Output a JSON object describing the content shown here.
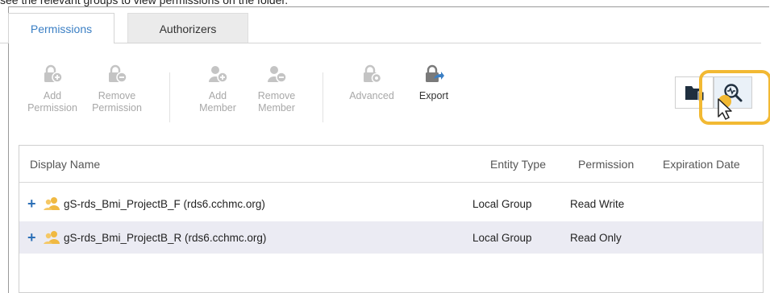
{
  "caption": "see the relevant groups to view permissions on the folder.",
  "tabs": [
    {
      "label": "Permissions",
      "active": true
    },
    {
      "label": "Authorizers",
      "active": false
    }
  ],
  "toolbar": {
    "add_permission": {
      "line1": "Add",
      "line2": "Permission",
      "icon": "lock-add-icon"
    },
    "remove_permission": {
      "line1": "Remove",
      "line2": "Permission",
      "icon": "lock-remove-icon"
    },
    "add_member": {
      "line1": "Add",
      "line2": "Member",
      "icon": "person-add-icon"
    },
    "remove_member": {
      "line1": "Remove",
      "line2": "Member",
      "icon": "person-remove-icon"
    },
    "advanced": {
      "label": "Advanced",
      "icon": "lock-gear-icon"
    },
    "export": {
      "label": "Export",
      "icon": "export-icon"
    }
  },
  "view_buttons": {
    "folder": {
      "icon": "folder-info-icon"
    },
    "inspect": {
      "icon": "magnifier-pulse-icon"
    }
  },
  "table": {
    "columns": [
      "Display Name",
      "Entity Type",
      "Permission",
      "Expiration Date"
    ],
    "rows": [
      {
        "name": "gS-rds_Bmi_ProjectB_F (rds6.cchmc.org)",
        "entity_type": "Local Group",
        "permission": "Read Write",
        "expiration": ""
      },
      {
        "name": "gS-rds_Bmi_ProjectB_R (rds6.cchmc.org)",
        "entity_type": "Local Group",
        "permission": "Read Only",
        "expiration": ""
      }
    ],
    "expand_symbol": "+"
  },
  "colors": {
    "accent": "#3b7fc4",
    "highlight": "#f2b933",
    "group_icon": "#f0b942",
    "disabled": "#a8a8a8"
  }
}
